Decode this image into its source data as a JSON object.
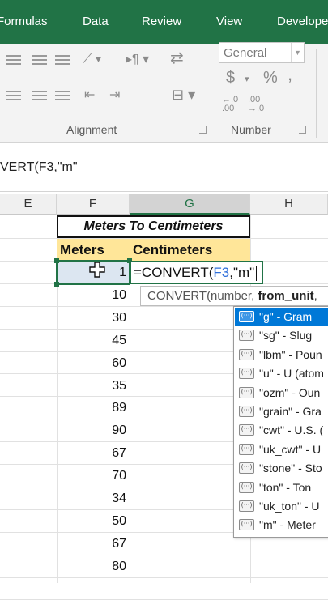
{
  "ribbon_tabs": [
    "Formulas",
    "Data",
    "Review",
    "View",
    "Develope"
  ],
  "ribbon": {
    "number_format": "General",
    "alignment_label": "Alignment",
    "number_label": "Number",
    "currency_symbol": "$",
    "percent_symbol": "%",
    "comma_symbol": ","
  },
  "formula_bar": {
    "text": "VERT(F3,\"m\""
  },
  "columns": [
    "E",
    "F",
    "G",
    "H"
  ],
  "sheet": {
    "title": "Meters To Centimeters",
    "header_meters": "Meters",
    "header_centimeters": "Centimeters",
    "meters": [
      "1",
      "10",
      "30",
      "45",
      "60",
      "35",
      "89",
      "90",
      "67",
      "70",
      "34",
      "50",
      "67",
      "80"
    ],
    "edit": {
      "prefix": "=CONVERT(",
      "ref": "F3",
      "suffix": ",\"m\""
    }
  },
  "tooltip": {
    "prefix": "CONVERT(number, ",
    "bold": "from_unit",
    "suffix": ","
  },
  "autocomplete": [
    "\"g\" - Gram",
    "\"sg\" - Slug",
    "\"lbm\" - Poun",
    "\"u\" - U (atom",
    "\"ozm\" - Oun",
    "\"grain\" - Gra",
    "\"cwt\" - U.S. (",
    "\"uk_cwt\" - U",
    "\"stone\" - Sto",
    "\"ton\" - Ton",
    "\"uk_ton\" - U",
    "\"m\" - Meter"
  ],
  "colors": {
    "excel_green": "#217346",
    "header_fill": "#ffe699",
    "selection_blue": "#0078d7"
  }
}
